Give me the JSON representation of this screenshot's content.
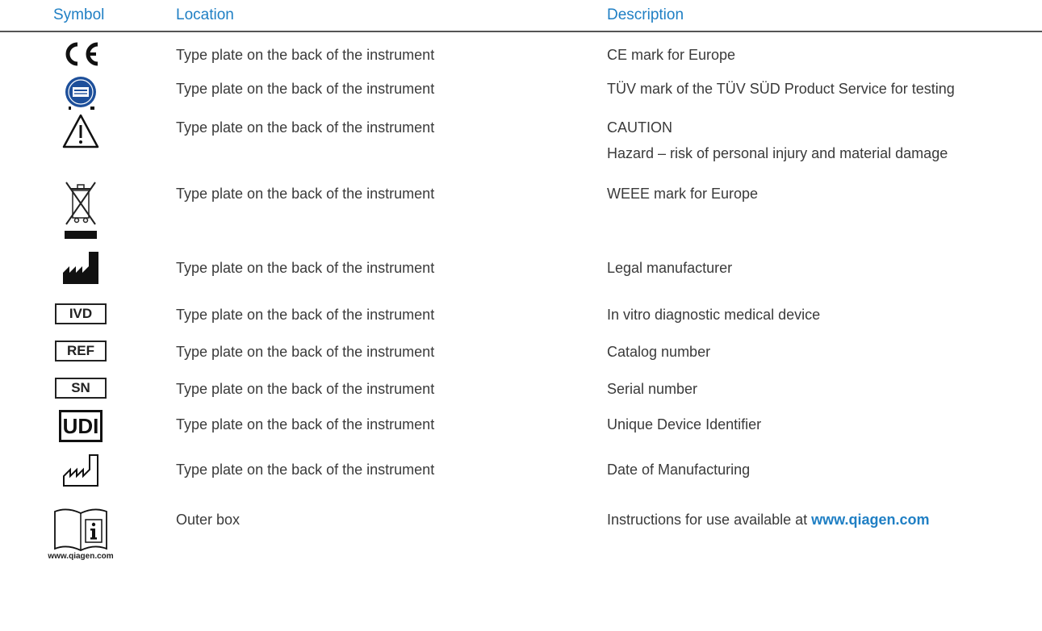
{
  "header": {
    "symbol": "Symbol",
    "location": "Location",
    "description": "Description"
  },
  "rows": [
    {
      "icon": "ce-mark-icon",
      "location": "Type plate on the back of the instrument",
      "description": "CE mark for Europe"
    },
    {
      "icon": "tuv-mark-icon",
      "location": "Type plate on the back of the instrument",
      "description": "TÜV mark of the TÜV SÜD Product Service for testing"
    },
    {
      "icon": "caution-triangle-icon",
      "location": "Type plate on the back of the instrument",
      "description": "CAUTION",
      "description_line2": "Hazard – risk of personal injury and material damage"
    },
    {
      "icon": "weee-bin-icon",
      "location": "Type plate on the back of the instrument",
      "description": "WEEE mark for Europe"
    },
    {
      "icon": "manufacturer-icon",
      "location": "Type plate on the back of the instrument",
      "description": "Legal manufacturer"
    },
    {
      "icon": "ivd-icon",
      "label": "IVD",
      "location": "Type plate on the back of the instrument",
      "description": "In vitro diagnostic medical device"
    },
    {
      "icon": "ref-icon",
      "label": "REF",
      "location": "Type plate on the back of the instrument",
      "description": "Catalog number"
    },
    {
      "icon": "sn-icon",
      "label": "SN",
      "location": "Type plate on the back of the instrument",
      "description": "Serial number"
    },
    {
      "icon": "udi-icon",
      "label": "UDI",
      "location": "Type plate on the back of the instrument",
      "description": "Unique Device Identifier"
    },
    {
      "icon": "date-of-manufacture-icon",
      "location": "Type plate on the back of the instrument",
      "description": "Date of Manufacturing"
    },
    {
      "icon": "instructions-book-icon",
      "icon_caption": "www.qiagen.com",
      "location": "Outer box",
      "description": "Instructions for use available at ",
      "description_link": "www.qiagen.com"
    }
  ]
}
